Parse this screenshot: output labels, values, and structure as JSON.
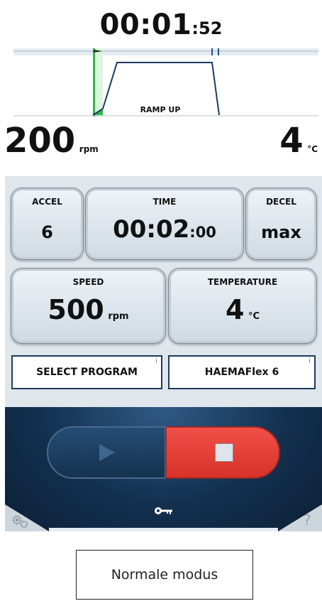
{
  "timer": {
    "main": "00:01",
    "seconds": ":52"
  },
  "profile": {
    "phase_label": "RAMP UP"
  },
  "current": {
    "speed": "200",
    "speed_unit": "rpm",
    "temperature": "4",
    "temperature_unit": "°C"
  },
  "settings": {
    "accel": {
      "label": "ACCEL",
      "value": "6"
    },
    "time": {
      "label": "TIME",
      "value_main": "00:02",
      "value_small": ":00"
    },
    "decel": {
      "label": "DECEL",
      "value": "max"
    },
    "speed": {
      "label": "SPEED",
      "value": "500",
      "unit": "rpm"
    },
    "temperature": {
      "label": "TEMPERATURE",
      "value": "4",
      "unit": "°C"
    }
  },
  "program": {
    "select_label": "SELECT PROGRAM",
    "current_program": "HAEMAFlex 6",
    "info_glyph": "i"
  },
  "controls": {
    "play_icon": "play-icon",
    "stop_icon": "stop-icon",
    "key_icon": "key-icon",
    "settings_icon": "gears-icon",
    "help_label": "?"
  },
  "caption": "Normale modus",
  "colors": {
    "stop_red": "#e63b33",
    "play_blue": "#1f4269",
    "panel_bg": "#dfe6ec",
    "ramp_green": "#2db84c"
  }
}
